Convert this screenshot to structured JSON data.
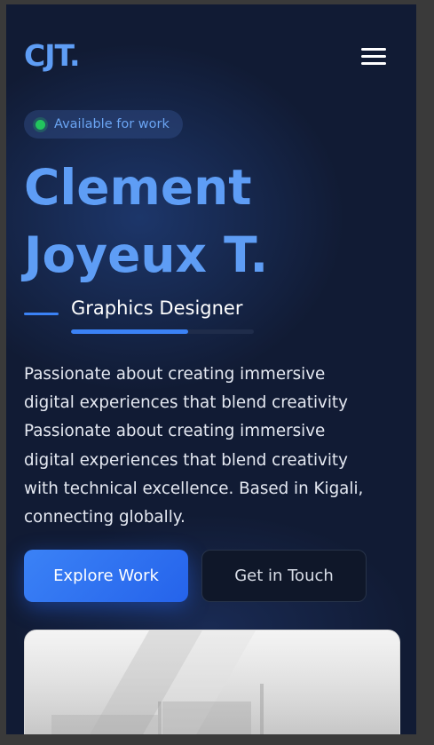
{
  "header": {
    "logo": "CJT.",
    "menu_icon": "hamburger-menu-icon"
  },
  "badge": {
    "status_color": "#22c55e",
    "text": "Available for work"
  },
  "hero": {
    "name_line1": "Clement",
    "name_line2": "Joyeux T.",
    "role": "Graphics Designer",
    "role_progress": 0.64,
    "description_lines": [
      "Passionate about creating immersive",
      "digital experiences that blend creativity",
      "Passionate about creating immersive",
      "digital experiences that blend creativity",
      "with technical excellence. Based in Kigali,",
      "connecting globally."
    ]
  },
  "actions": {
    "primary_label": "Explore Work",
    "secondary_label": "Get in Touch"
  },
  "colors": {
    "accent": "#5e9df5",
    "primary_button": "#2563eb",
    "background": "#111b34"
  }
}
